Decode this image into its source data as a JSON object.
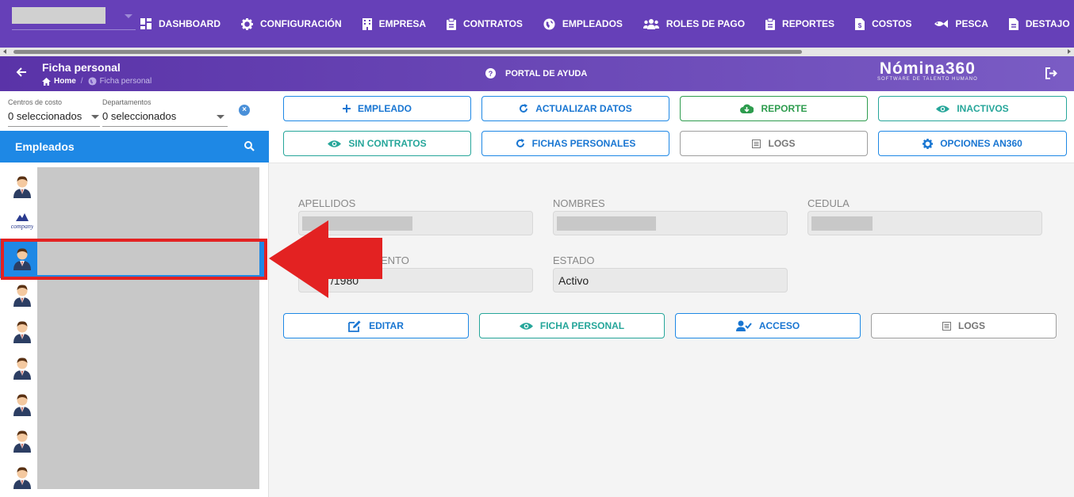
{
  "topnav": {
    "items": [
      {
        "label": "DASHBOARD",
        "icon": "dashboard-icon"
      },
      {
        "label": "CONFIGURACIÓN",
        "icon": "gear-icon"
      },
      {
        "label": "EMPRESA",
        "icon": "building-icon"
      },
      {
        "label": "CONTRATOS",
        "icon": "clipboard-icon"
      },
      {
        "label": "EMPLEADOS",
        "icon": "globe-icon"
      },
      {
        "label": "ROLES DE PAGO",
        "icon": "users-icon"
      },
      {
        "label": "REPORTES",
        "icon": "clipboard-icon"
      },
      {
        "label": "COSTOS",
        "icon": "invoice-icon"
      },
      {
        "label": "PESCA",
        "icon": "fish-icon"
      },
      {
        "label": "DESTAJO",
        "icon": "document-icon"
      }
    ]
  },
  "header": {
    "title": "Ficha personal",
    "breadcrumb_home": "Home",
    "breadcrumb_current": "Ficha personal",
    "help_label": "PORTAL DE AYUDA",
    "logo_text": "Nómina360",
    "logo_tagline": "SOFTWARE DE TALENTO HUMANO"
  },
  "filters": {
    "cost_centers_label": "Centros de costo",
    "cost_centers_value": "0 seleccionados",
    "departments_label": "Departamentos",
    "departments_value": "0 seleccionados"
  },
  "employees_panel": {
    "title": "Empleados",
    "avatars": [
      "person",
      "company",
      "person",
      "person",
      "person",
      "person",
      "person",
      "person",
      "person"
    ],
    "company_logo_text": "company",
    "selected_index": 2
  },
  "toolbar": {
    "row1": [
      {
        "label": "EMPLEADO",
        "icon": "plus-icon",
        "style": "blue"
      },
      {
        "label": "ACTUALIZAR DATOS",
        "icon": "refresh-icon",
        "style": "blue"
      },
      {
        "label": "REPORTE",
        "icon": "cloud-download-icon",
        "style": "green"
      },
      {
        "label": "INACTIVOS",
        "icon": "eye-icon",
        "style": "teal"
      }
    ],
    "row2": [
      {
        "label": "SIN CONTRATOS",
        "icon": "eye-icon",
        "style": "teal"
      },
      {
        "label": "FICHAS PERSONALES",
        "icon": "refresh-icon",
        "style": "blue"
      },
      {
        "label": "LOGS",
        "icon": "list-icon",
        "style": "gray"
      },
      {
        "label": "OPCIONES AN360",
        "icon": "gear-icon",
        "style": "blue"
      }
    ]
  },
  "detail": {
    "apellidos_label": "APELLIDOS",
    "nombres_label": "NOMBRES",
    "cedula_label": "CEDULA",
    "nacimiento_label": "ENTO",
    "nacimiento_value": "/1980",
    "estado_label": "ESTADO",
    "estado_value": "Activo"
  },
  "actions": [
    {
      "label": "EDITAR",
      "icon": "edit-icon",
      "style": "blue"
    },
    {
      "label": "FICHA PERSONAL",
      "icon": "eye-icon",
      "style": "teal"
    },
    {
      "label": "ACCESO",
      "icon": "user-check-icon",
      "style": "blue"
    },
    {
      "label": "LOGS",
      "icon": "list-icon",
      "style": "gray"
    }
  ],
  "colors": {
    "topbar": "#6640b8",
    "accent": "#1e88e5",
    "annotation": "#e32222"
  }
}
